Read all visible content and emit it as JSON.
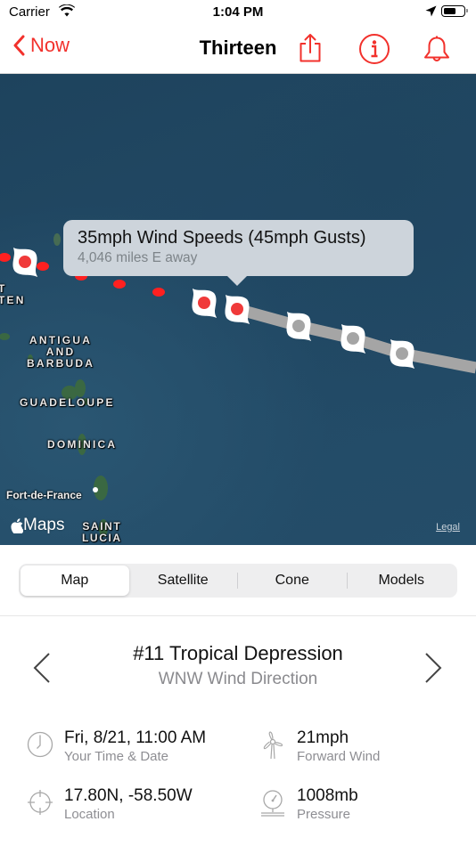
{
  "status_bar": {
    "carrier": "Carrier",
    "time": "1:04 PM",
    "icons": [
      "wifi-icon",
      "location-arrow-icon",
      "battery-icon"
    ]
  },
  "nav": {
    "back_label": "Now",
    "title": "Thirteen",
    "icons": [
      "share-icon",
      "info-icon",
      "bell-icon"
    ],
    "accent_color": "#f2312c"
  },
  "map": {
    "callout": {
      "title": "35mph Wind Speeds (45mph Gusts)",
      "subtitle": "4,046 miles E away"
    },
    "labels": {
      "sint_maarten_line1": "T",
      "sint_maarten_line2": "TEN",
      "antigua": "ANTIGUA",
      "and": "AND",
      "barbuda": "BARBUDA",
      "guadeloupe": "GUADELOUPE",
      "dominica": "DOMINICA",
      "fort_de_france": "Fort-de-France",
      "saint": "SAINT",
      "lucia": "LUCIA"
    },
    "maps_brand": "Maps",
    "legal": "Legal",
    "track": {
      "past_color": "#ff2d2d",
      "forecast_color": "#a8a8a8",
      "markers": [
        {
          "type": "past",
          "color": "#f03a3a"
        },
        {
          "type": "past",
          "color": "#f03a3a"
        },
        {
          "type": "current",
          "color": "#f03a3a"
        },
        {
          "type": "forecast",
          "color": "#a5a5a5"
        },
        {
          "type": "forecast",
          "color": "#a5a5a5"
        },
        {
          "type": "forecast",
          "color": "#a5a5a5"
        }
      ]
    }
  },
  "segments": [
    {
      "label": "Map",
      "active": true
    },
    {
      "label": "Satellite",
      "active": false
    },
    {
      "label": "Cone",
      "active": false
    },
    {
      "label": "Models",
      "active": false
    }
  ],
  "storm": {
    "title": "#11 Tropical Depression",
    "subtitle": "WNW Wind Direction"
  },
  "details": [
    {
      "icon": "clock-icon",
      "value": "Fri, 8/21, 11:00 AM",
      "label": "Your Time & Date"
    },
    {
      "icon": "wind-turbine-icon",
      "value": "21mph",
      "label": "Forward Wind"
    },
    {
      "icon": "crosshair-icon",
      "value": "17.80N, -58.50W",
      "label": "Location"
    },
    {
      "icon": "barometer-icon",
      "value": "1008mb",
      "label": "Pressure"
    }
  ]
}
